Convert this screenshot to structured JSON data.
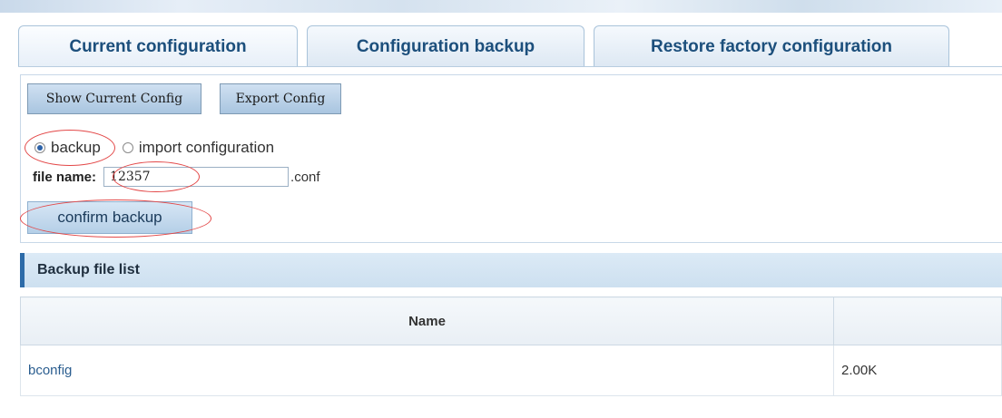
{
  "tabs": [
    {
      "label": "Current configuration"
    },
    {
      "label": "Configuration backup"
    },
    {
      "label": "Restore factory configuration"
    }
  ],
  "toolbar": {
    "show_config_label": "Show Current Config",
    "export_config_label": "Export Config"
  },
  "mode": {
    "backup_label": "backup",
    "import_label": "import configuration",
    "selected": "backup"
  },
  "file": {
    "label": "file name:",
    "value": "12357",
    "suffix": ".conf"
  },
  "confirm_label": "confirm backup",
  "backup_list": {
    "title": "Backup file list",
    "columns": [
      "Name",
      ""
    ],
    "rows": [
      {
        "name": "bconfig",
        "size": "2.00K"
      }
    ]
  },
  "colors": {
    "annotation": "#e34848",
    "accent": "#2d6ba8"
  }
}
